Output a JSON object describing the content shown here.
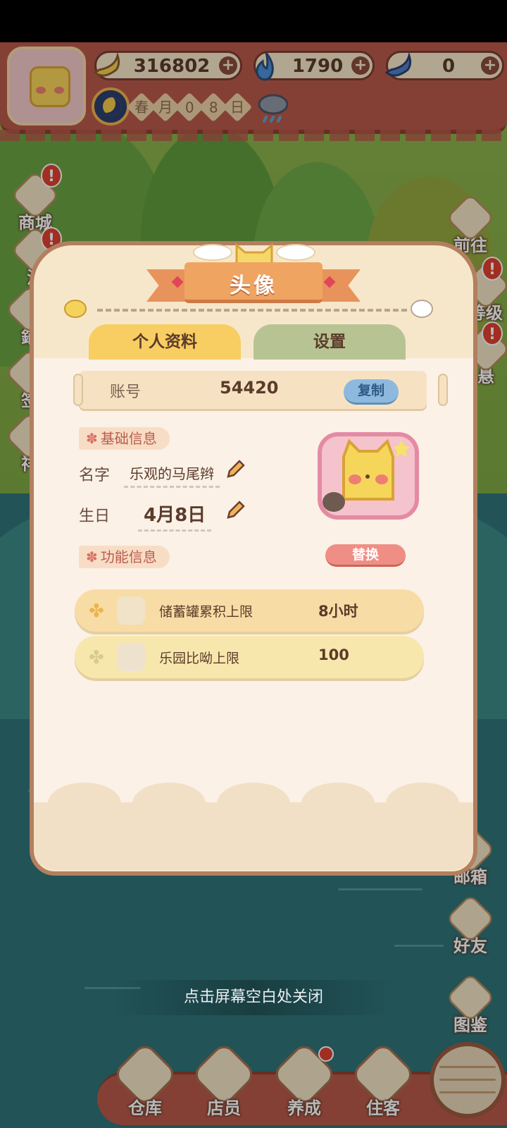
{
  "hud": {
    "currencies": [
      {
        "name": "banana",
        "value": "316802"
      },
      {
        "name": "fire",
        "value": "1790"
      },
      {
        "name": "gem",
        "value": "0"
      }
    ],
    "date_cells": [
      "春",
      "月",
      "0",
      "8",
      "日"
    ],
    "plus_symbol": "+"
  },
  "side_left": {
    "items": [
      {
        "label": "商城",
        "alert": "!"
      },
      {
        "label": "活",
        "alert": "!"
      },
      {
        "label": "鋪",
        "alert": ""
      },
      {
        "label": "签",
        "alert": ""
      },
      {
        "label": "祥",
        "alert": ""
      }
    ]
  },
  "side_right": {
    "items": [
      {
        "label": "前往",
        "alert": ""
      },
      {
        "label": "等级",
        "alert": "!"
      },
      {
        "label": "悬",
        "alert": "!"
      },
      {
        "label": "邮箱",
        "alert": ""
      },
      {
        "label": "好友",
        "alert": ""
      },
      {
        "label": "图鉴",
        "alert": ""
      }
    ]
  },
  "dialog": {
    "title": "头像",
    "tabs": {
      "profile": "个人资料",
      "settings": "设置"
    },
    "account": {
      "label": "账号",
      "value": "54420",
      "copy": "复制"
    },
    "basic_section": "基础信息",
    "name_label": "名字",
    "name_value": "乐观的马尾辫",
    "birthday_label": "生日",
    "birthday_value": "4月8日",
    "function_section": "功能信息",
    "replace": "替换",
    "stats": [
      {
        "name": "储蓄罐累积上限",
        "value": "8小时",
        "color": "#f8dca5"
      },
      {
        "name": "乐园比呦上限",
        "value": "100",
        "color": "#f7e7ad"
      }
    ]
  },
  "close_hint": "点击屏幕空白处关闭",
  "dock": {
    "items": [
      "仓库",
      "店员",
      "养成",
      "住客"
    ]
  },
  "colors": {
    "hud_red": "#b9594a",
    "tab_active": "#f8ce62",
    "tab_inactive": "#b7c393",
    "copy_blue": "#8db9de",
    "replace_pink": "#ee8e85"
  }
}
